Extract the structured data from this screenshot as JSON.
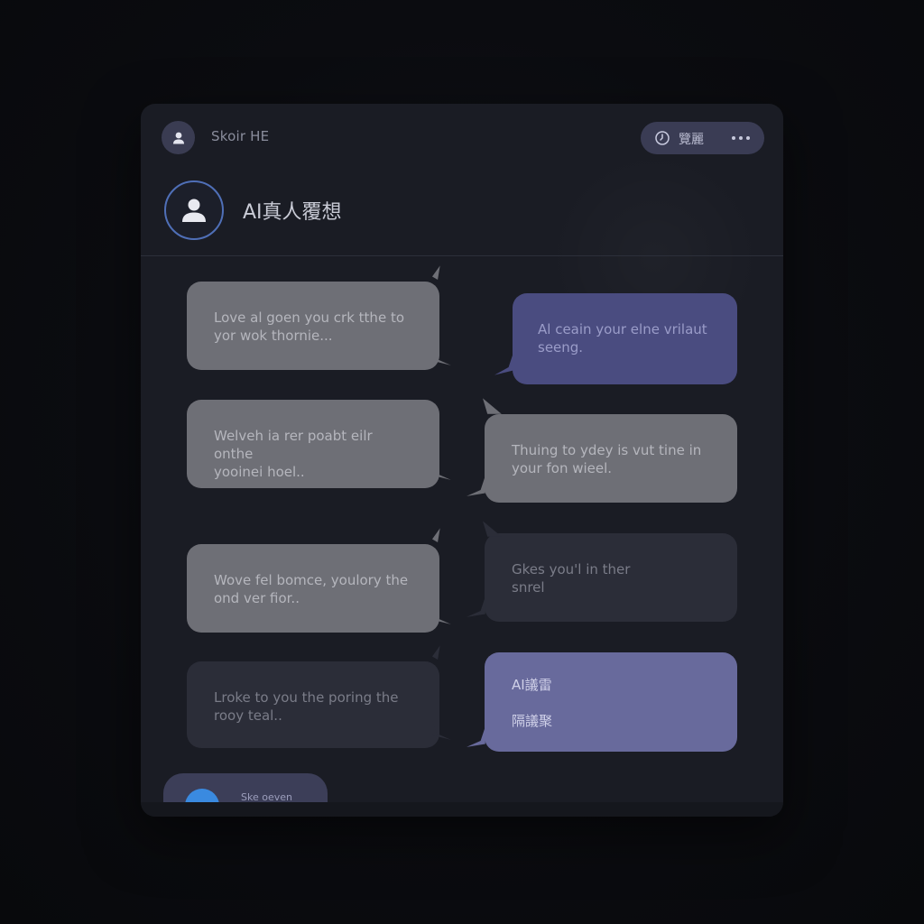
{
  "app": {
    "title": "Skoir HE",
    "menu_label": "覽麗",
    "menu_icon": "clock-icon",
    "more_icon": "more-dots-icon"
  },
  "chat": {
    "title": "AI真人覆想",
    "avatar_icon": "user-icon"
  },
  "messages": [
    {
      "side": "left",
      "style": "gray",
      "lines": [
        "Love al goen you crk tthe to",
        "yor wok thornie..."
      ]
    },
    {
      "side": "right",
      "style": "blue",
      "lines": [
        "Al ceain your elne vrilaut",
        "seeng."
      ]
    },
    {
      "side": "left",
      "style": "gray",
      "lines": [
        "Welveh ia rer poabt eilr onthe",
        "yooinei hoel.."
      ]
    },
    {
      "side": "right",
      "style": "gray",
      "lines": [
        "Thuing to ydey is vut tine in",
        "your fon wieel."
      ]
    },
    {
      "side": "left",
      "style": "gray",
      "lines": [
        "Wove fel bomce, youlory the",
        "ond ver fior.."
      ]
    },
    {
      "side": "right",
      "style": "dark",
      "lines": [
        "Gkes you'l in ther",
        "snrel"
      ]
    },
    {
      "side": "left",
      "style": "dark",
      "lines": [
        "Lroke to you the poring the",
        "rooy teal.."
      ]
    },
    {
      "side": "right",
      "style": "lavender",
      "lines": [
        "AI議雷",
        "",
        "隔議聚"
      ]
    }
  ],
  "composer": {
    "label": "Ske oeven"
  },
  "colors": {
    "background": "#090a0e",
    "window": "#1a1c24",
    "bubble_gray": "#6e6f76",
    "bubble_dark": "#2b2d38",
    "bubble_blue": "#4a4c80",
    "bubble_lavender": "#686a9c",
    "avatar_ring": "#4f6fb7",
    "accent_dot": "#3a8ae0"
  }
}
